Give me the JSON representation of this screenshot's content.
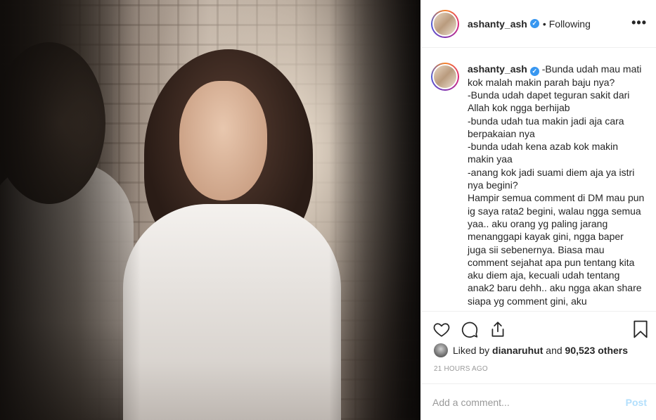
{
  "header": {
    "username": "ashanty_ash",
    "separator": "•",
    "follow_status": "Following",
    "more_icon": "more-horizontal-icon"
  },
  "caption": {
    "username": "ashanty_ash",
    "text": "-Bunda udah mau mati kok malah makin parah baju nya?\n-Bunda udah dapet teguran sakit dari Allah kok ngga berhijab\n-bunda udah tua makin jadi aja cara berpakaian nya\n-bunda udah kena azab kok makin makin yaa\n-anang kok jadi suami diem aja ya istri nya begini?\nHampir semua comment di DM mau pun ig saya rata2 begini, walau ngga semua yaa.. aku orang yg paling jarang menanggapi kayak gini, ngga baper juga sii sebenernya. Biasa mau comment sejahat apa pun tentang kita aku diem aja, kecuali udah tentang anak2 baru dehh.. aku ngga akan share siapa yg comment gini, aku"
  },
  "actions": {
    "like_icon": "heart-icon",
    "comment_icon": "comment-icon",
    "share_icon": "share-icon",
    "save_icon": "bookmark-icon"
  },
  "likes": {
    "prefix": "Liked by ",
    "user": "dianaruhut",
    "middle": " and ",
    "count": "90,523 others"
  },
  "timestamp": "21 HOURS AGO",
  "add_comment": {
    "placeholder": "Add a comment...",
    "post_label": "Post"
  },
  "colors": {
    "verified": "#3897f0",
    "post_disabled": "#b2dffc",
    "muted": "#999999"
  }
}
